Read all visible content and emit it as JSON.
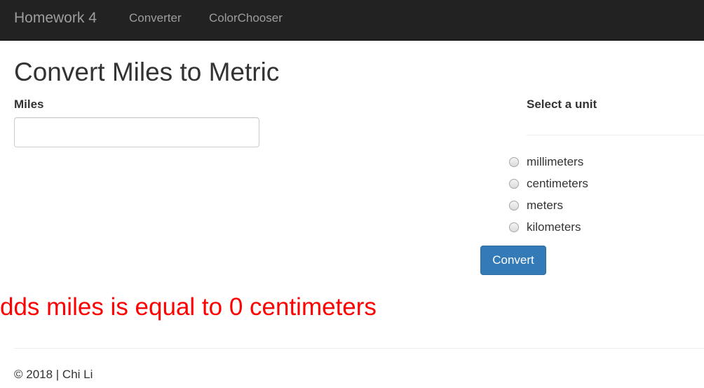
{
  "navbar": {
    "brand": "Homework 4",
    "links": [
      "Converter",
      "ColorChooser"
    ]
  },
  "page": {
    "title": "Convert Miles to Metric"
  },
  "form": {
    "miles_label": "Miles",
    "miles_value": "",
    "unit_label": "Select a unit",
    "units": [
      "millimeters",
      "centimeters",
      "meters",
      "kilometers"
    ],
    "convert_label": "Convert"
  },
  "result": {
    "text": "dds miles is equal to 0 centimeters",
    "color": "#ff0000"
  },
  "footer": {
    "text": "© 2018 | Chi Li"
  },
  "colors": {
    "navbar_bg": "#222222",
    "nav_text": "#9d9d9d",
    "button_bg": "#337ab7"
  }
}
